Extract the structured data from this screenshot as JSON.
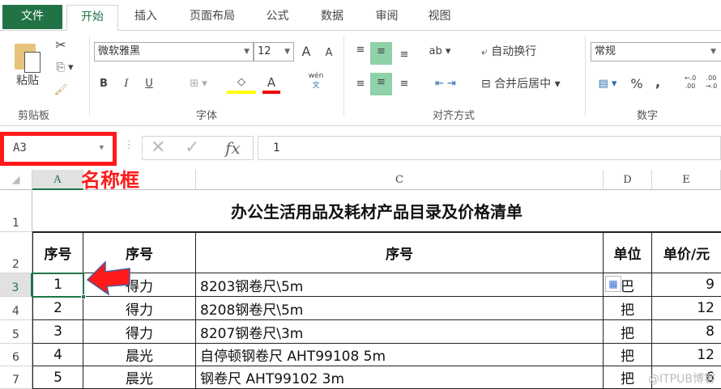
{
  "tabs": [
    "文件",
    "开始",
    "插入",
    "页面布局",
    "公式",
    "数据",
    "审阅",
    "视图"
  ],
  "clipboard": {
    "paste": "粘贴",
    "label": "剪贴板"
  },
  "font": {
    "name": "微软雅黑",
    "size": "12",
    "bold": "B",
    "italic": "I",
    "underline": "U",
    "grow": "A",
    "shrink": "A",
    "phonetic": "wén",
    "phonetic2": "文",
    "label": "字体"
  },
  "alignment": {
    "wrap": "自动换行",
    "merge": "合并后居中",
    "label": "对齐方式"
  },
  "number": {
    "format": "常规",
    "percent": "%",
    "comma": ",",
    "inc": "←.0 .00",
    "dec": ".00 →.0",
    "label": "数字"
  },
  "formula_bar": {
    "name_box": "A3",
    "fx": "fx",
    "value": "1"
  },
  "annotation": "名称框",
  "columns": [
    "A",
    "C",
    "D",
    "E"
  ],
  "rows": [
    "1",
    "2",
    "3",
    "4",
    "5",
    "6",
    "7"
  ],
  "sheet": {
    "title": "办公生活用品及耗材产品目录及价格清单",
    "headers": [
      "序号",
      "序号",
      "序号",
      "单位",
      "单价/元"
    ],
    "data": [
      [
        "1",
        "得力",
        "8203钢卷尺\\5m",
        "巴",
        "9"
      ],
      [
        "2",
        "得力",
        "8208钢卷尺\\5m",
        "把",
        "12"
      ],
      [
        "3",
        "得力",
        "8207钢卷尺\\3m",
        "把",
        "8"
      ],
      [
        "4",
        "晨光",
        "自停顿钢卷尺 AHT99108 5m",
        "把",
        "12"
      ],
      [
        "5",
        "晨光",
        "钢卷尺 AHT99102 3m",
        "把",
        "6"
      ]
    ]
  },
  "watermark": "@ITPUB博客",
  "colors": {
    "accent": "#217346",
    "highlight": "#ff0000"
  }
}
